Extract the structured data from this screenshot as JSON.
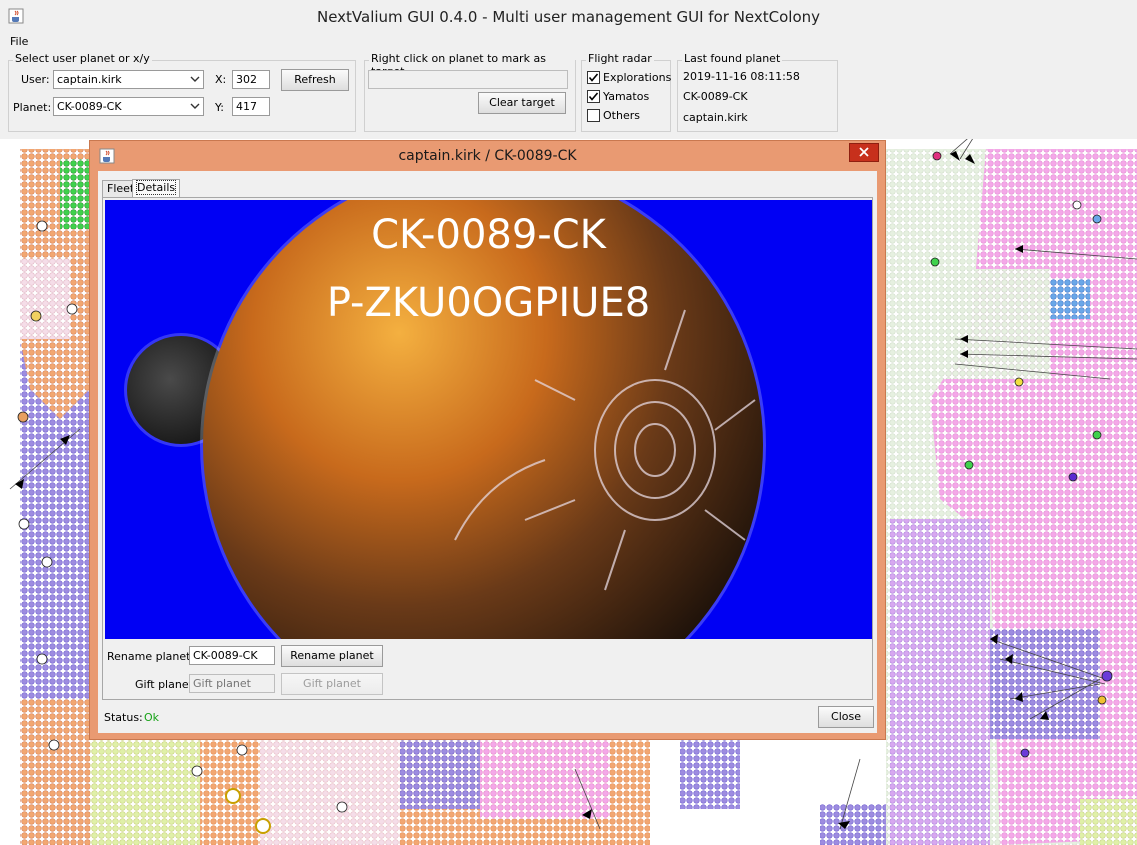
{
  "window": {
    "title": "NextValium GUI 0.4.0 - Multi user management GUI for NextColony"
  },
  "menu": {
    "file": "File"
  },
  "select_group": {
    "title": "Select user planet or x/y",
    "user_label": "User:",
    "user_value": "captain.kirk",
    "planet_label": "Planet:",
    "planet_value": "CK-0089-CK",
    "x_label": "X:",
    "x_value": "302",
    "y_label": "Y:",
    "y_value": "417",
    "refresh": "Refresh"
  },
  "target_group": {
    "title": "Right click on planet to mark as target",
    "target_value": "",
    "clear_target": "Clear target"
  },
  "radar_group": {
    "title": "Flight radar",
    "items": [
      {
        "label": "Explorations",
        "checked": true
      },
      {
        "label": "Yamatos",
        "checked": true
      },
      {
        "label": "Others",
        "checked": false
      }
    ]
  },
  "last_found": {
    "title": "Last found planet",
    "date": "2019-11-16 08:11:58",
    "planet": "CK-0089-CK",
    "user": "captain.kirk"
  },
  "dialog": {
    "title": "captain.kirk / CK-0089-CK",
    "tabs": [
      {
        "label": "Fleet",
        "active": false
      },
      {
        "label": "Details",
        "active": true
      }
    ],
    "planet_name": "CK-0089-CK",
    "planet_id": "P-ZKU0OGPIUE8",
    "rename_label": "Rename planet:",
    "rename_value": "CK-0089-CK",
    "rename_button": "Rename planet",
    "gift_label": "Gift planet:",
    "gift_placeholder": "Gift planet",
    "gift_button": "Gift planet",
    "status_label": "Status:",
    "status_value": "Ok",
    "close_button": "Close"
  },
  "colors": {
    "dialog_frame": "#e99a72",
    "close_red": "#c7301c",
    "planet_bg": "#0000f4",
    "status_ok": "#16a316"
  },
  "icons": {
    "app": "java-cup-icon",
    "dropdown": "chevron-down-icon",
    "close": "close-icon"
  }
}
